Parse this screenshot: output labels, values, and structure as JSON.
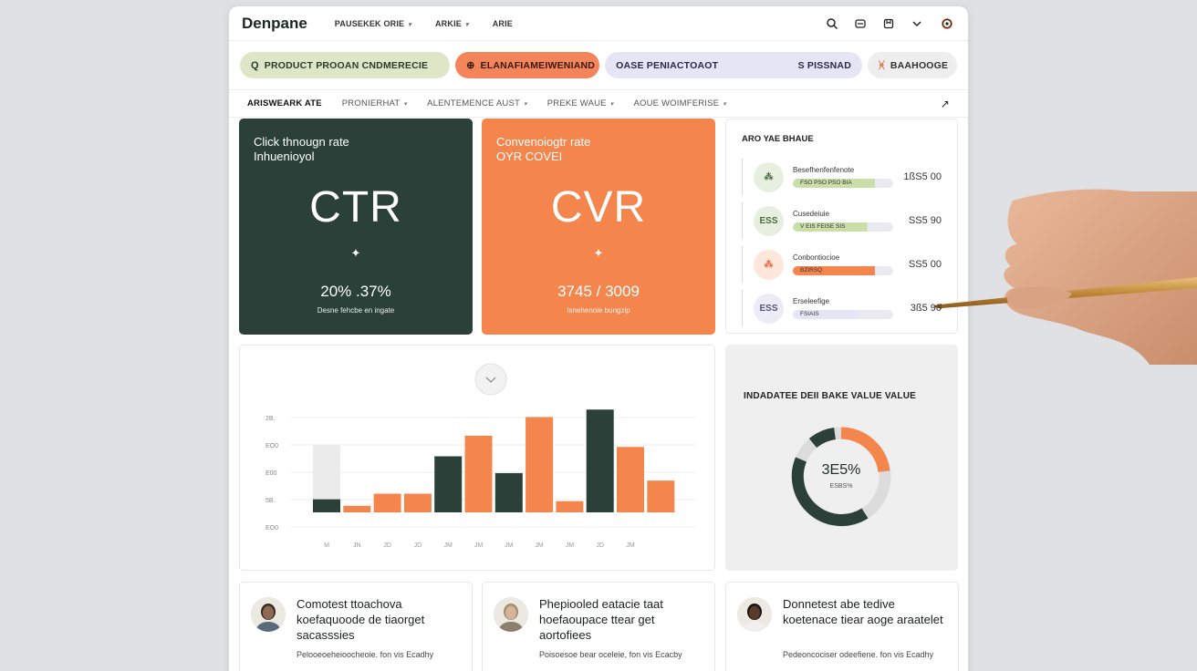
{
  "app": {
    "brand": "Denpane"
  },
  "topmenu": [
    {
      "label": "PAUSEKEK ORIE"
    },
    {
      "label": "ARKIE"
    },
    {
      "label": "ARIE"
    }
  ],
  "topicons": [
    "search-icon",
    "chat-icon",
    "box-icon",
    "chevron-down-icon",
    "settings-icon"
  ],
  "pills": [
    {
      "icon": "Q",
      "label": "PRODUCT PROOAN CNDMERECIE"
    },
    {
      "icon": "⊕",
      "label": "ELANAFIAMEIWENIAND"
    },
    {
      "label": "OASE PENIACTOAOT",
      "right": "S PISSNAD"
    },
    {
      "icon": "ᚸ",
      "label": "BAAHOOGE"
    }
  ],
  "subnav": [
    {
      "label": "ARISWEARK ATE",
      "active": true
    },
    {
      "label": "PRONIERHAT"
    },
    {
      "label": "ALENTEMENCE AUST"
    },
    {
      "label": "PREKE WAUE"
    },
    {
      "label": "AOUE WOIMFERISE"
    }
  ],
  "kpi_ctr": {
    "title": "Click thnougn rate",
    "subtitle": "Inhuenioyol",
    "big": "CTR",
    "spark": "✦",
    "value": "20% .37%",
    "caption": "Desne fehcbe en ingate"
  },
  "kpi_cvr": {
    "title": "Convenoiogtr rate",
    "subtitle": "OYR COVEI",
    "big": "CVR",
    "spark": "✦",
    "value": "3745 / 3009",
    "caption": "Isnehenoie bungzip"
  },
  "avg_list": {
    "title": "ARO YAE BHAUE",
    "rows": [
      {
        "icon": "⁂",
        "name": "Besefhenfenfenote",
        "bar_label": "FSO PSO PSO BIA",
        "amount": "1ßS5 00",
        "color": "#c9dea9",
        "fill": 0.82,
        "avatar_bg": "#e6efe0",
        "avatar_color": "#4a6b3b"
      },
      {
        "icon": "ESS",
        "name": "Cusedeiuie",
        "bar_label": "V EIS FEISE SIS",
        "amount": "SS5 90",
        "color": "#c9dea9",
        "fill": 0.74,
        "avatar_bg": "#e6efe0",
        "avatar_color": "#4a6b3b"
      },
      {
        "icon": "⁂",
        "name": "Conbontiocioe",
        "bar_label": "BZIRSQ",
        "amount": "SS5 00",
        "color": "#f4854d",
        "fill": 0.82,
        "avatar_bg": "#fde6da",
        "avatar_color": "#e06a3b"
      },
      {
        "icon": "ESS",
        "name": "Erseleefige",
        "bar_label": "FSIAIS",
        "amount": "3ß5 90",
        "color": "#e6e5f5",
        "fill": 0.66,
        "avatar_bg": "#ecebf6",
        "avatar_color": "#555577"
      }
    ]
  },
  "chart_data": {
    "type": "bar",
    "categories": [
      "M",
      "JN",
      "JD",
      "JD",
      "JM",
      "JM",
      "JM",
      "JM",
      "JM",
      "JD",
      "JM"
    ],
    "yticks": [
      "2B.",
      "EO0",
      "E00",
      "5B.",
      "EO0"
    ],
    "values": [
      0.7,
      0.35,
      1.0,
      1.0,
      3.0,
      4.1,
      2.1,
      5.1,
      0.6,
      5.5,
      3.5,
      1.7
    ],
    "colors": [
      "#2b4039",
      "#f4854d",
      "#f4854d",
      "#f4854d",
      "#2b4039",
      "#f4854d",
      "#2b4039",
      "#f4854d",
      "#f4854d",
      "#2b4039",
      "#f4854d",
      "#f4854d"
    ],
    "ghost_value": 3.6,
    "ymax": 6.0
  },
  "donut": {
    "title": "INDADATEE DEII BAKE VALUE VALUE",
    "value": "3E5%",
    "caption": "ESBS%"
  },
  "testimonials": [
    {
      "title": "Comotest ttoachova koefaquoode de tiaorget sacasssies",
      "sub": "Pelooeoeheioocheoie. fon vis Ecadhy",
      "skin": "#8e6a52",
      "hair": "#3a2a20",
      "cloth": "#5a6a7a"
    },
    {
      "title": "Phepiooled eatacie taat hoefaoupace ttear get aortofiees",
      "sub": "Poisoesoe bear oceleie, fon vis Ecacby",
      "skin": "#d4b49a",
      "hair": "#a88a6a",
      "cloth": "#8a8070"
    },
    {
      "title": "Donnetest abe tedive koetenace tiear aoge araatelet",
      "sub": "Pedeoncociser odeefiene. fon vis Ecadhy",
      "skin": "#5a3a2a",
      "hair": "#1a1210",
      "cloth": "#f0f0ee"
    }
  ]
}
